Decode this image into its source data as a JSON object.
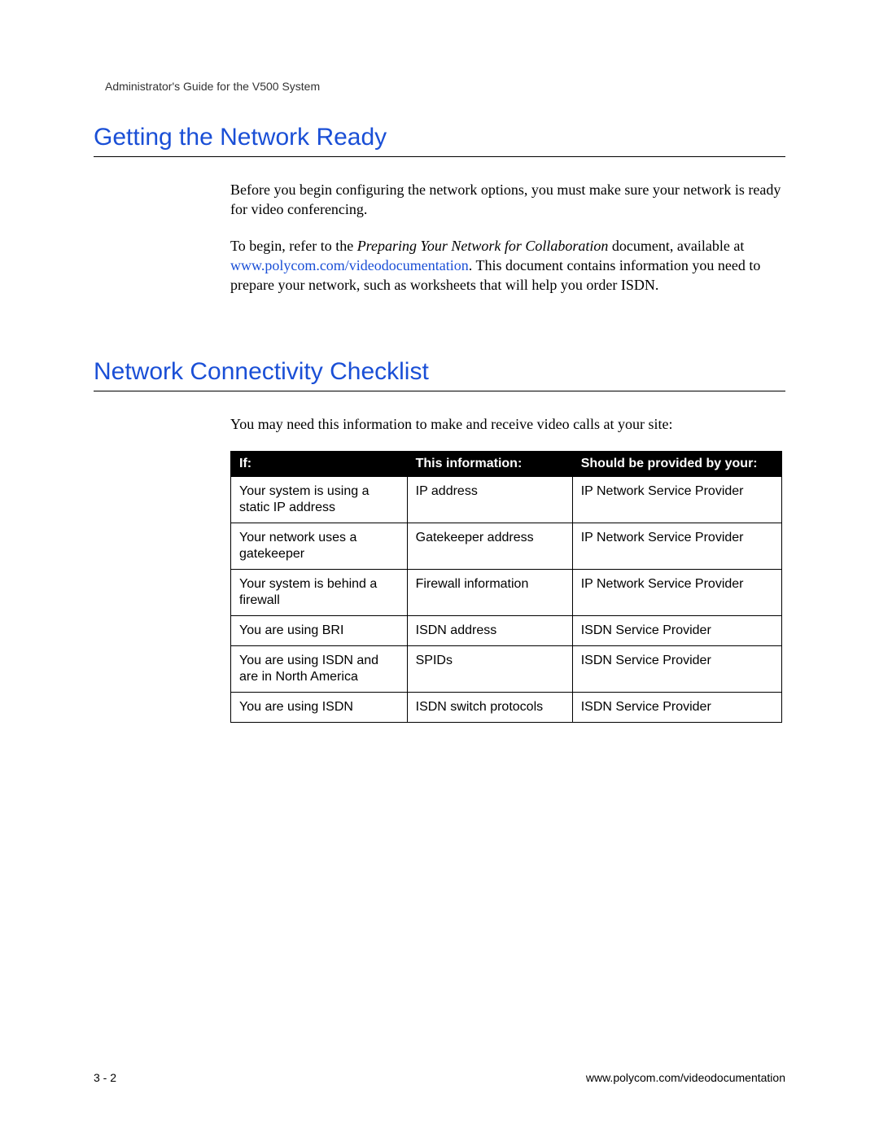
{
  "header": {
    "running_title": "Administrator's Guide for the V500 System"
  },
  "section1": {
    "heading": "Getting the Network Ready",
    "para1": "Before you begin configuring the network options, you must make sure your network is ready for video conferencing.",
    "para2_pre": "To begin, refer to the ",
    "para2_doc": "Preparing Your Network for Collaboration",
    "para2_mid": " document, available at ",
    "para2_link": "www.polycom.com/videodocumentation",
    "para2_post": ". This document contains information you need to prepare your network, such as worksheets that will help you order ISDN."
  },
  "section2": {
    "heading": "Network Connectivity Checklist",
    "intro": "You may need this information to make and receive video calls at your site:",
    "table": {
      "headers": {
        "col1": "If:",
        "col2": "This information:",
        "col3": "Should be provided by your:"
      },
      "rows": [
        {
          "c1": "Your system is using a static IP address",
          "c2": "IP address",
          "c3": "IP Network Service Provider"
        },
        {
          "c1": "Your network uses a gatekeeper",
          "c2": "Gatekeeper address",
          "c3": "IP Network Service Provider"
        },
        {
          "c1": "Your system is behind a firewall",
          "c2": "Firewall information",
          "c3": "IP Network Service Provider"
        },
        {
          "c1": "You are using BRI",
          "c2": "ISDN address",
          "c3": "ISDN Service Provider"
        },
        {
          "c1": "You are using ISDN and are in North America",
          "c2": "SPIDs",
          "c3": "ISDN Service Provider"
        },
        {
          "c1": "You are using ISDN",
          "c2": "ISDN switch protocols",
          "c3": "ISDN Service Provider"
        }
      ]
    }
  },
  "footer": {
    "page_num": "3 - 2",
    "url": "www.polycom.com/videodocumentation"
  }
}
